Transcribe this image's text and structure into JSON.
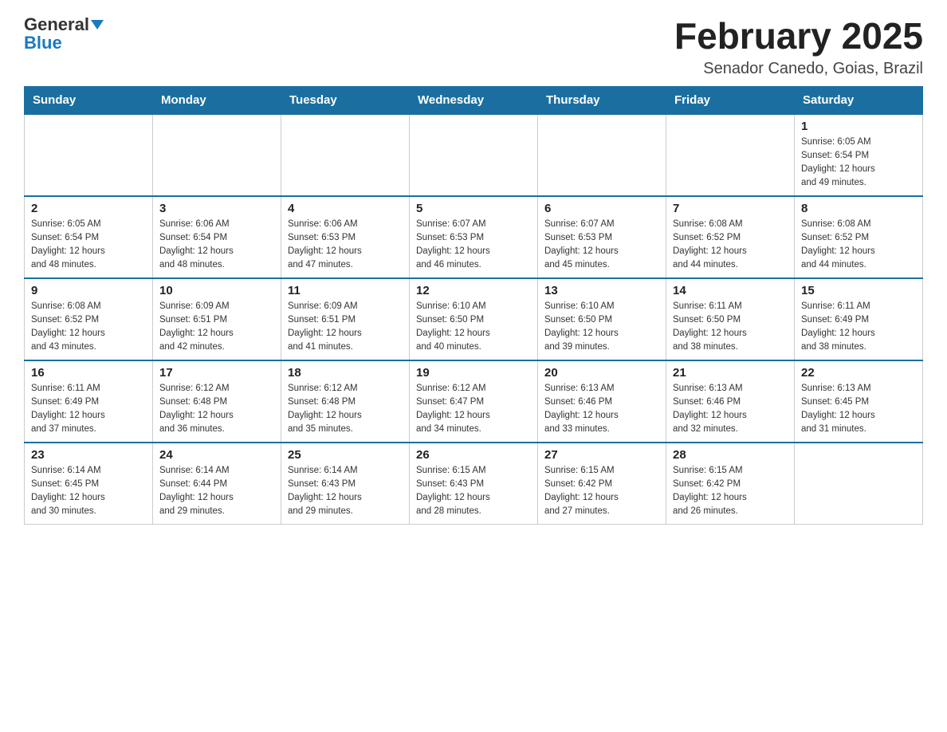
{
  "logo": {
    "general": "General",
    "blue": "Blue"
  },
  "title": {
    "month": "February 2025",
    "location": "Senador Canedo, Goias, Brazil"
  },
  "headers": [
    "Sunday",
    "Monday",
    "Tuesday",
    "Wednesday",
    "Thursday",
    "Friday",
    "Saturday"
  ],
  "weeks": [
    [
      {
        "day": "",
        "info": ""
      },
      {
        "day": "",
        "info": ""
      },
      {
        "day": "",
        "info": ""
      },
      {
        "day": "",
        "info": ""
      },
      {
        "day": "",
        "info": ""
      },
      {
        "day": "",
        "info": ""
      },
      {
        "day": "1",
        "info": "Sunrise: 6:05 AM\nSunset: 6:54 PM\nDaylight: 12 hours\nand 49 minutes."
      }
    ],
    [
      {
        "day": "2",
        "info": "Sunrise: 6:05 AM\nSunset: 6:54 PM\nDaylight: 12 hours\nand 48 minutes."
      },
      {
        "day": "3",
        "info": "Sunrise: 6:06 AM\nSunset: 6:54 PM\nDaylight: 12 hours\nand 48 minutes."
      },
      {
        "day": "4",
        "info": "Sunrise: 6:06 AM\nSunset: 6:53 PM\nDaylight: 12 hours\nand 47 minutes."
      },
      {
        "day": "5",
        "info": "Sunrise: 6:07 AM\nSunset: 6:53 PM\nDaylight: 12 hours\nand 46 minutes."
      },
      {
        "day": "6",
        "info": "Sunrise: 6:07 AM\nSunset: 6:53 PM\nDaylight: 12 hours\nand 45 minutes."
      },
      {
        "day": "7",
        "info": "Sunrise: 6:08 AM\nSunset: 6:52 PM\nDaylight: 12 hours\nand 44 minutes."
      },
      {
        "day": "8",
        "info": "Sunrise: 6:08 AM\nSunset: 6:52 PM\nDaylight: 12 hours\nand 44 minutes."
      }
    ],
    [
      {
        "day": "9",
        "info": "Sunrise: 6:08 AM\nSunset: 6:52 PM\nDaylight: 12 hours\nand 43 minutes."
      },
      {
        "day": "10",
        "info": "Sunrise: 6:09 AM\nSunset: 6:51 PM\nDaylight: 12 hours\nand 42 minutes."
      },
      {
        "day": "11",
        "info": "Sunrise: 6:09 AM\nSunset: 6:51 PM\nDaylight: 12 hours\nand 41 minutes."
      },
      {
        "day": "12",
        "info": "Sunrise: 6:10 AM\nSunset: 6:50 PM\nDaylight: 12 hours\nand 40 minutes."
      },
      {
        "day": "13",
        "info": "Sunrise: 6:10 AM\nSunset: 6:50 PM\nDaylight: 12 hours\nand 39 minutes."
      },
      {
        "day": "14",
        "info": "Sunrise: 6:11 AM\nSunset: 6:50 PM\nDaylight: 12 hours\nand 38 minutes."
      },
      {
        "day": "15",
        "info": "Sunrise: 6:11 AM\nSunset: 6:49 PM\nDaylight: 12 hours\nand 38 minutes."
      }
    ],
    [
      {
        "day": "16",
        "info": "Sunrise: 6:11 AM\nSunset: 6:49 PM\nDaylight: 12 hours\nand 37 minutes."
      },
      {
        "day": "17",
        "info": "Sunrise: 6:12 AM\nSunset: 6:48 PM\nDaylight: 12 hours\nand 36 minutes."
      },
      {
        "day": "18",
        "info": "Sunrise: 6:12 AM\nSunset: 6:48 PM\nDaylight: 12 hours\nand 35 minutes."
      },
      {
        "day": "19",
        "info": "Sunrise: 6:12 AM\nSunset: 6:47 PM\nDaylight: 12 hours\nand 34 minutes."
      },
      {
        "day": "20",
        "info": "Sunrise: 6:13 AM\nSunset: 6:46 PM\nDaylight: 12 hours\nand 33 minutes."
      },
      {
        "day": "21",
        "info": "Sunrise: 6:13 AM\nSunset: 6:46 PM\nDaylight: 12 hours\nand 32 minutes."
      },
      {
        "day": "22",
        "info": "Sunrise: 6:13 AM\nSunset: 6:45 PM\nDaylight: 12 hours\nand 31 minutes."
      }
    ],
    [
      {
        "day": "23",
        "info": "Sunrise: 6:14 AM\nSunset: 6:45 PM\nDaylight: 12 hours\nand 30 minutes."
      },
      {
        "day": "24",
        "info": "Sunrise: 6:14 AM\nSunset: 6:44 PM\nDaylight: 12 hours\nand 29 minutes."
      },
      {
        "day": "25",
        "info": "Sunrise: 6:14 AM\nSunset: 6:43 PM\nDaylight: 12 hours\nand 29 minutes."
      },
      {
        "day": "26",
        "info": "Sunrise: 6:15 AM\nSunset: 6:43 PM\nDaylight: 12 hours\nand 28 minutes."
      },
      {
        "day": "27",
        "info": "Sunrise: 6:15 AM\nSunset: 6:42 PM\nDaylight: 12 hours\nand 27 minutes."
      },
      {
        "day": "28",
        "info": "Sunrise: 6:15 AM\nSunset: 6:42 PM\nDaylight: 12 hours\nand 26 minutes."
      },
      {
        "day": "",
        "info": ""
      }
    ]
  ]
}
